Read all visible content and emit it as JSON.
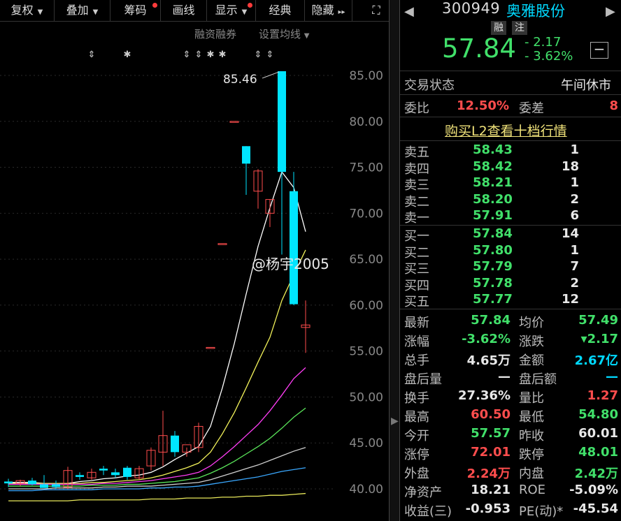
{
  "toolbar": {
    "items": [
      {
        "label": "复权",
        "arrow": "▼",
        "dot": false
      },
      {
        "label": "叠加",
        "arrow": "▼",
        "dot": false
      },
      {
        "label": "筹码",
        "arrow": "",
        "dot": true
      },
      {
        "label": "画线",
        "arrow": "",
        "dot": false
      },
      {
        "label": "显示",
        "arrow": "▼",
        "dot": true
      },
      {
        "label": "经典",
        "arrow": "",
        "dot": false
      },
      {
        "label": "隐藏",
        "arrow": "▸▸",
        "dot": false
      }
    ],
    "expand_icon": "⛶"
  },
  "settings": {
    "margin_link": "融资融券",
    "ma_link": "设置均线",
    "ma_arrow": "▼"
  },
  "chart_data": {
    "type": "candlestick",
    "y_ticks": [
      "85.00",
      "80.00",
      "75.00",
      "70.00",
      "65.00",
      "60.00",
      "55.00",
      "50.00",
      "45.00",
      "40.00"
    ],
    "ylim": [
      38.5,
      87
    ],
    "max_label": "85.46",
    "event_markers": [
      "⇕",
      "✱",
      "⇕",
      "⇕",
      "✱",
      "✱",
      "⇕",
      "⇕"
    ],
    "up_color": "#ff4d4d",
    "down_color": "#00e5ff",
    "candles": [
      {
        "o": 40.8,
        "h": 41.1,
        "l": 40.2,
        "c": 40.6
      },
      {
        "o": 40.6,
        "h": 41.0,
        "l": 40.3,
        "c": 40.9
      },
      {
        "o": 40.9,
        "h": 41.2,
        "l": 40.4,
        "c": 40.5
      },
      {
        "o": 40.5,
        "h": 41.5,
        "l": 40.2,
        "c": 40.1
      },
      {
        "o": 40.5,
        "h": 40.9,
        "l": 40.0,
        "c": 40.2
      },
      {
        "o": 40.2,
        "h": 42.4,
        "l": 40.0,
        "c": 42.0
      },
      {
        "o": 41.5,
        "h": 41.8,
        "l": 41.0,
        "c": 41.3
      },
      {
        "o": 41.2,
        "h": 42.2,
        "l": 41.0,
        "c": 41.8
      },
      {
        "o": 42.2,
        "h": 42.5,
        "l": 41.5,
        "c": 42.0
      },
      {
        "o": 41.8,
        "h": 42.2,
        "l": 41.2,
        "c": 41.5
      },
      {
        "o": 42.3,
        "h": 42.5,
        "l": 41.0,
        "c": 41.3
      },
      {
        "o": 41.2,
        "h": 42.5,
        "l": 41.0,
        "c": 42.2
      },
      {
        "o": 42.5,
        "h": 44.5,
        "l": 42.0,
        "c": 44.2
      },
      {
        "o": 44.0,
        "h": 48.5,
        "l": 42.5,
        "c": 45.8
      },
      {
        "o": 45.8,
        "h": 46.3,
        "l": 43.5,
        "c": 44.0
      },
      {
        "o": 44.0,
        "h": 44.5,
        "l": 43.5,
        "c": 44.8
      },
      {
        "o": 44.5,
        "h": 47.2,
        "l": 44.0,
        "c": 46.8
      },
      {
        "o": 55.4,
        "h": 55.4,
        "l": 55.4,
        "c": 55.4
      },
      {
        "o": 66.7,
        "h": 66.7,
        "l": 66.7,
        "c": 66.7
      },
      {
        "o": 80.0,
        "h": 80.0,
        "l": 80.0,
        "c": 80.0
      },
      {
        "o": 77.3,
        "h": 77.3,
        "l": 72.0,
        "c": 75.4
      },
      {
        "o": 72.4,
        "h": 74.8,
        "l": 70.5,
        "c": 74.6
      },
      {
        "o": 70.0,
        "h": 71.5,
        "l": 68.5,
        "c": 71.5
      },
      {
        "o": 85.46,
        "h": 85.46,
        "l": 65.5,
        "c": 74.5
      },
      {
        "o": 72.4,
        "h": 74.5,
        "l": 60.0,
        "c": 60.1
      },
      {
        "o": 57.57,
        "h": 60.5,
        "l": 54.8,
        "c": 57.84
      }
    ],
    "ma_series": [
      {
        "color": "#ffffff",
        "values": [
          40.7,
          40.7,
          40.7,
          40.6,
          40.6,
          40.6,
          40.8,
          40.9,
          41.1,
          41.2,
          41.4,
          41.5,
          41.8,
          42.4,
          43.2,
          43.9,
          44.6,
          46.8,
          51.0,
          55.8,
          61.2,
          66.4,
          70.6,
          74.5,
          72.8,
          68.0
        ]
      },
      {
        "color": "#f2f25a",
        "values": [
          40.6,
          40.6,
          40.6,
          40.6,
          40.6,
          40.6,
          40.6,
          40.7,
          40.7,
          40.8,
          40.9,
          41.0,
          41.2,
          41.5,
          41.9,
          42.3,
          42.8,
          44.0,
          46.0,
          48.3,
          51.0,
          53.8,
          56.5,
          60.5,
          63.3,
          66.0
        ]
      },
      {
        "color": "#ff3df5",
        "values": [
          40.5,
          40.5,
          40.5,
          40.5,
          40.5,
          40.5,
          40.5,
          40.5,
          40.6,
          40.6,
          40.7,
          40.8,
          40.9,
          41.1,
          41.3,
          41.5,
          41.8,
          42.5,
          43.5,
          44.6,
          45.8,
          47.0,
          48.5,
          50.2,
          52.0,
          53.2
        ]
      },
      {
        "color": "#5ae65a",
        "values": [
          40.3,
          40.3,
          40.3,
          40.3,
          40.3,
          40.3,
          40.3,
          40.4,
          40.4,
          40.4,
          40.5,
          40.5,
          40.6,
          40.7,
          40.8,
          41.0,
          41.2,
          41.7,
          42.3,
          43.0,
          43.8,
          44.6,
          45.5,
          46.6,
          47.8,
          48.8
        ]
      },
      {
        "color": "#d0d0d0",
        "values": [
          40.0,
          40.0,
          40.0,
          40.0,
          40.1,
          40.1,
          40.1,
          40.1,
          40.2,
          40.2,
          40.3,
          40.3,
          40.3,
          40.4,
          40.5,
          40.6,
          40.7,
          41.0,
          41.4,
          41.8,
          42.2,
          42.6,
          43.1,
          43.6,
          44.1,
          44.5
        ]
      },
      {
        "color": "#3aa8ff",
        "values": [
          39.8,
          39.8,
          39.8,
          39.9,
          39.9,
          39.9,
          39.9,
          39.9,
          40.0,
          40.0,
          40.0,
          40.0,
          40.1,
          40.1,
          40.2,
          40.2,
          40.3,
          40.5,
          40.7,
          40.9,
          41.1,
          41.3,
          41.6,
          41.9,
          42.1,
          42.3
        ]
      },
      {
        "color": "#e8e85a",
        "values": [
          38.7,
          38.7,
          38.7,
          38.7,
          38.7,
          38.7,
          38.8,
          38.8,
          38.8,
          38.8,
          38.8,
          38.8,
          38.9,
          38.9,
          38.9,
          39.0,
          39.0,
          39.0,
          39.1,
          39.1,
          39.2,
          39.2,
          39.3,
          39.3,
          39.4,
          39.5
        ]
      }
    ]
  },
  "watermark": "@杨宇2005",
  "quote": {
    "code": "300949",
    "name": "奥雅股份",
    "tag_margin": "融",
    "tag_note": "注",
    "price": "57.84",
    "change": "- 2.17",
    "change_pct": "- 3.62%",
    "minus_btn": "−"
  },
  "status": {
    "trade_label": "交易状态",
    "trade_value": "午间休市",
    "weibi_label": "委比",
    "weibi_value": "12.50%",
    "weicha_label": "委差",
    "weicha_value": "8"
  },
  "l2_link": "购买L2查看十档行情",
  "orderbook": {
    "asks": [
      {
        "label": "卖五",
        "price": "58.43",
        "qty": "1"
      },
      {
        "label": "卖四",
        "price": "58.42",
        "qty": "18"
      },
      {
        "label": "卖三",
        "price": "58.21",
        "qty": "1"
      },
      {
        "label": "卖二",
        "price": "58.20",
        "qty": "2"
      },
      {
        "label": "卖一",
        "price": "57.91",
        "qty": "6"
      }
    ],
    "bids": [
      {
        "label": "买一",
        "price": "57.84",
        "qty": "14"
      },
      {
        "label": "买二",
        "price": "57.80",
        "qty": "1"
      },
      {
        "label": "买三",
        "price": "57.79",
        "qty": "7"
      },
      {
        "label": "买四",
        "price": "57.78",
        "qty": "2"
      },
      {
        "label": "买五",
        "price": "57.77",
        "qty": "12"
      }
    ]
  },
  "stats": [
    {
      "l1": "最新",
      "v1": "57.84",
      "c1": "green",
      "l2": "均价",
      "v2": "57.49",
      "c2": "green"
    },
    {
      "l1": "涨幅",
      "v1": "-3.62%",
      "c1": "green",
      "l2": "涨跌",
      "v2": "▾2.17",
      "c2": "green"
    },
    {
      "l1": "总手",
      "v1": "4.65万",
      "c1": "white",
      "l2": "金额",
      "v2": "2.67亿",
      "c2": "cyan"
    },
    {
      "l1": "盘后量",
      "v1": "—",
      "c1": "white",
      "l2": "盘后额",
      "v2": "—",
      "c2": "cyan"
    },
    {
      "l1": "换手",
      "v1": "27.36%",
      "c1": "white",
      "l2": "量比",
      "v2": "1.27",
      "c2": "red"
    },
    {
      "l1": "最高",
      "v1": "60.50",
      "c1": "red",
      "l2": "最低",
      "v2": "54.80",
      "c2": "green"
    },
    {
      "l1": "今开",
      "v1": "57.57",
      "c1": "green",
      "l2": "昨收",
      "v2": "60.01",
      "c2": "white"
    },
    {
      "l1": "涨停",
      "v1": "72.01",
      "c1": "red",
      "l2": "跌停",
      "v2": "48.01",
      "c2": "green"
    },
    {
      "l1": "外盘",
      "v1": "2.24万",
      "c1": "red",
      "l2": "内盘",
      "v2": "2.42万",
      "c2": "green"
    },
    {
      "l1": "净资产",
      "v1": "18.21",
      "c1": "white",
      "l2": "ROE",
      "v2": "-5.09%",
      "c2": "white"
    },
    {
      "l1": "收益(三)",
      "v1": "-0.953",
      "c1": "white",
      "l2": "PE(动)*",
      "v2": "-45.54",
      "c2": "white"
    }
  ]
}
